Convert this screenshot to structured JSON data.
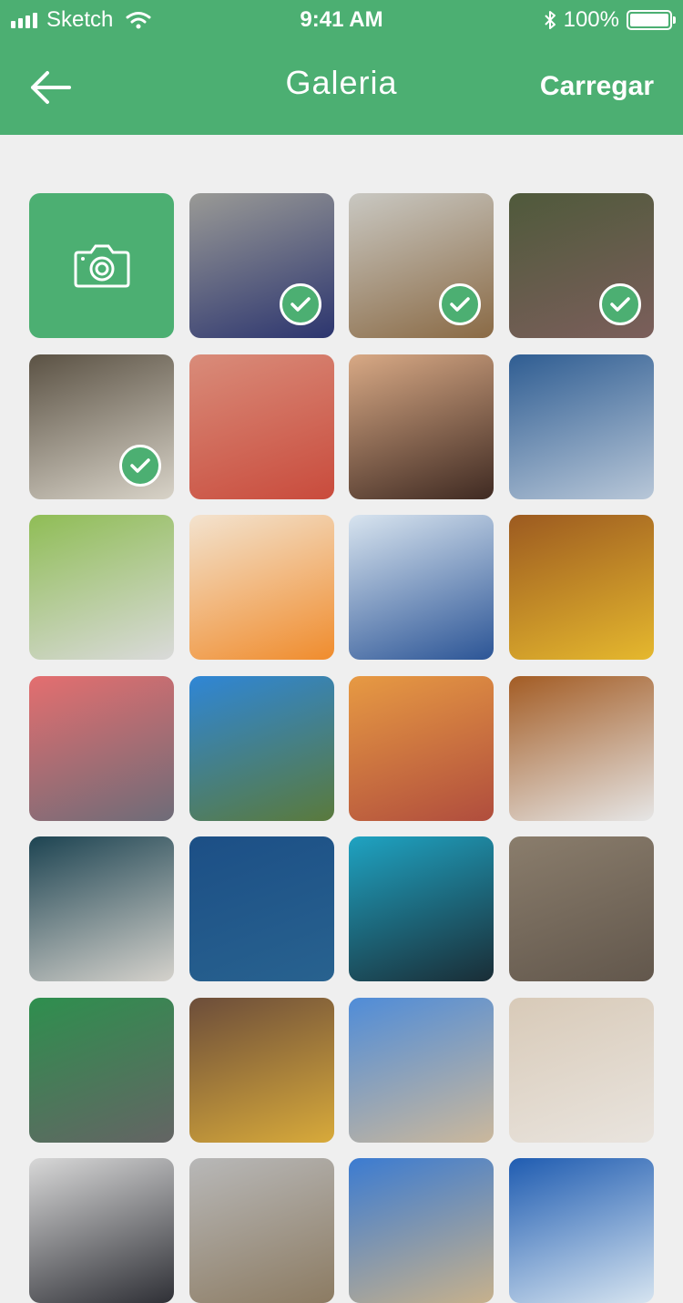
{
  "status_bar": {
    "carrier": "Sketch",
    "time": "9:41 AM",
    "battery": "100%"
  },
  "nav": {
    "title": "Galeria",
    "upload_label": "Carregar",
    "back_icon": "arrow-left-icon"
  },
  "gallery": {
    "camera_icon": "camera-icon",
    "photos": [
      {
        "selected": true,
        "colors": [
          "#9a9a96",
          "#2c356f"
        ]
      },
      {
        "selected": true,
        "colors": [
          "#c9c8c2",
          "#8a6a45"
        ]
      },
      {
        "selected": true,
        "colors": [
          "#4f5a3b",
          "#7b5e5b"
        ]
      },
      {
        "selected": true,
        "colors": [
          "#5b5244",
          "#d8d3c8"
        ]
      },
      {
        "selected": false,
        "colors": [
          "#d98c7a",
          "#c94b3c"
        ]
      },
      {
        "selected": false,
        "colors": [
          "#d8a985",
          "#3f2a22"
        ]
      },
      {
        "selected": false,
        "colors": [
          "#2f5d92",
          "#b8c7d8"
        ]
      },
      {
        "selected": false,
        "colors": [
          "#8fbd55",
          "#dadada"
        ]
      },
      {
        "selected": false,
        "colors": [
          "#f3e3cf",
          "#f08c2d"
        ]
      },
      {
        "selected": false,
        "colors": [
          "#d8e4ef",
          "#2c5596"
        ]
      },
      {
        "selected": false,
        "colors": [
          "#9c5a20",
          "#e5b82e"
        ]
      },
      {
        "selected": false,
        "colors": [
          "#e46e6f",
          "#6e6c78"
        ]
      },
      {
        "selected": false,
        "colors": [
          "#2f86d6",
          "#5a7a3c"
        ]
      },
      {
        "selected": false,
        "colors": [
          "#e79a43",
          "#b04d3d"
        ]
      },
      {
        "selected": false,
        "colors": [
          "#a35c24",
          "#e6e6e6"
        ]
      },
      {
        "selected": false,
        "colors": [
          "#1d4452",
          "#d5d2cc"
        ]
      },
      {
        "selected": false,
        "colors": [
          "#1c4f86",
          "#28628f"
        ]
      },
      {
        "selected": false,
        "colors": [
          "#1fa3c2",
          "#1a2d36"
        ]
      },
      {
        "selected": false,
        "colors": [
          "#8a7d6c",
          "#62574c"
        ]
      },
      {
        "selected": false,
        "colors": [
          "#2e8f4e",
          "#646464"
        ]
      },
      {
        "selected": false,
        "colors": [
          "#6c4d3a",
          "#d8aa3a"
        ]
      },
      {
        "selected": false,
        "colors": [
          "#4f8cd8",
          "#cbb89c"
        ]
      },
      {
        "selected": false,
        "colors": [
          "#d8cab8",
          "#e9e4de"
        ]
      },
      {
        "selected": false,
        "colors": [
          "#d8d8d8",
          "#2f3036"
        ]
      },
      {
        "selected": false,
        "colors": [
          "#b8b8b8",
          "#8c7b62"
        ]
      },
      {
        "selected": false,
        "colors": [
          "#3b7bd1",
          "#c7b18c"
        ]
      },
      {
        "selected": false,
        "colors": [
          "#1f5cb1",
          "#d6e4f0"
        ]
      }
    ]
  },
  "colors": {
    "accent": "#4caf72",
    "background": "#efefef"
  }
}
